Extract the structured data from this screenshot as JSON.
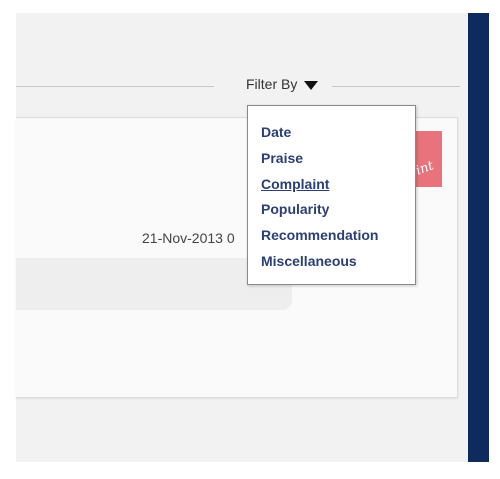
{
  "filter": {
    "label": "Filter By",
    "options": [
      "Date",
      "Praise",
      "Complaint",
      "Popularity",
      "Recommendation",
      "Miscellaneous"
    ],
    "hovered_option": "Complaint"
  },
  "post": {
    "timestamp": "21-Nov-2013 0",
    "stamp_text": "int"
  },
  "colors": {
    "side_rail": "#0f2a5c",
    "menu_text": "#2a3f73",
    "stamp": "#e8737c"
  },
  "icons": {
    "filter_toggle": "caret-down-icon"
  }
}
